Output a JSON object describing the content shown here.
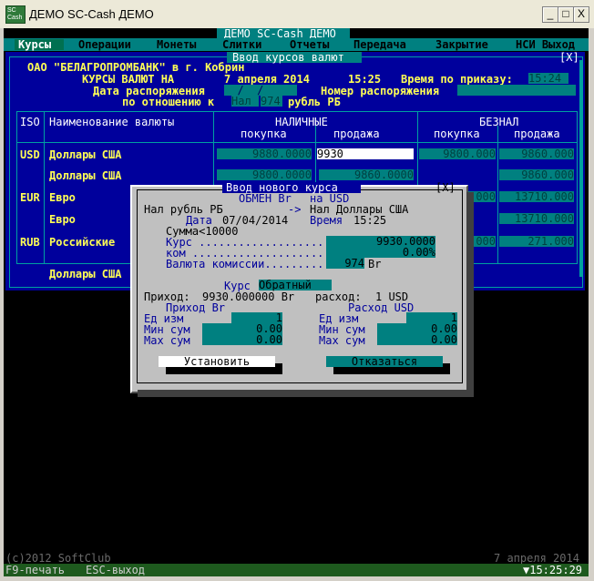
{
  "window": {
    "title": "ДЕМО SC-Cash ДЕМО",
    "app_icon_text": "SC\nCash",
    "minimize": "_",
    "maximize": "□",
    "close": "X"
  },
  "header": {
    "title": "ДЕМО SC-Cash ДЕМО"
  },
  "menu": [
    {
      "label": "Курсы",
      "active": true
    },
    {
      "label": "Операции"
    },
    {
      "label": "Монеты"
    },
    {
      "label": "Слитки"
    },
    {
      "label": "Отчеты"
    },
    {
      "label": "Передача"
    },
    {
      "label": "Закрытие"
    },
    {
      "label": "НСИ Выход"
    }
  ],
  "rates_panel": {
    "title": "Ввод курсов валют",
    "close": "[X]",
    "bank_line": "ОАО \"БЕЛАГРОПРОМБАНК\" в г. Кобрин",
    "rates_as_of_label": "КУРСЫ ВАЛЮТ НА",
    "rates_date": "7 апреля 2014",
    "rates_time": "15:25",
    "order_time_label": "Время по приказу:",
    "order_time": "15:24",
    "order_date_label": "Дата распоряжения",
    "order_date": "  /  /",
    "order_number_label": "Номер распоряжения",
    "relative_label": "по отношению к",
    "relative_type": "Нал",
    "relative_code": "974",
    "relative_currency": "рубль РБ",
    "col_iso": "ISO",
    "col_name": "Наименование валюты",
    "col_cash": "НАЛИЧНЫЕ",
    "col_noncash": "БЕЗНАЛ",
    "col_buy": "покупка",
    "col_sell": "продажа",
    "rows": [
      {
        "iso": "USD",
        "name": "Доллары США",
        "cash_buy": "9880.0000",
        "cash_sell": "9930",
        "noncash_buy": "9800.000",
        "noncash_sell": "9860.000"
      },
      {
        "iso": "",
        "name": "Доллары США",
        "cash_buy": "9800.0000",
        "cash_sell": "9860.0000",
        "noncash_buy": "",
        "noncash_sell": "9860.000"
      },
      {
        "iso": "EUR",
        "name": "Евро",
        "cash_buy": "",
        "cash_sell": "",
        "noncash_buy": ".000",
        "noncash_sell": "13710.000"
      },
      {
        "iso": "",
        "name": "Евро",
        "cash_buy": "",
        "cash_sell": "",
        "noncash_buy": "",
        "noncash_sell": "13710.000"
      },
      {
        "iso": "RUB",
        "name": "Российские",
        "cash_buy": "",
        "cash_sell": "",
        "noncash_buy": ".000",
        "noncash_sell": "271.000"
      }
    ],
    "bottom_row_name": "Доллары США"
  },
  "dialog": {
    "title": "Ввод нового курса",
    "close": "[X]",
    "exchange_label": "ОБМЕН Br",
    "exchange_for": "на USD",
    "from_currency": "Нал рубль РБ",
    "arrow": "->",
    "to_currency": "Нал Доллары США",
    "date_label": "Дата",
    "date": "07/04/2014",
    "time_label": "Время",
    "time": "15:25",
    "amount_label": "Сумма<10000",
    "rate_label": "Курс ...................",
    "rate_value": "9930.0000",
    "commission_label": "ком ....................",
    "commission_value": "0.00%",
    "commission_currency_label": "Валюта комиссии.........",
    "commission_currency_code": "974",
    "commission_currency_unit": "Br",
    "rate_type_label": "Курс",
    "rate_type_value": "Обратный",
    "summary_income_label": "Приход:",
    "summary_income_value": "9930.000000 Br",
    "summary_expense_label": "расход:",
    "summary_expense_value": "1 USD",
    "income_header": "Приход Br",
    "expense_header": "Расход USD",
    "unit_label": "Ед изм",
    "min_label": "Мин сум",
    "max_label": "Max сум",
    "income_unit": "1",
    "income_min": "0.00",
    "income_max": "0.00",
    "expense_unit": "1",
    "expense_min": "0.00",
    "expense_max": "0.00",
    "set_button": "Установить",
    "cancel_button": "Отказаться"
  },
  "footer": {
    "copyright": "(c)2012 SoftClub",
    "date": "7 апреля 2014",
    "hint_f9": "F9-печать",
    "hint_esc": "ESC-выход",
    "clock": "▼15:25:29"
  }
}
